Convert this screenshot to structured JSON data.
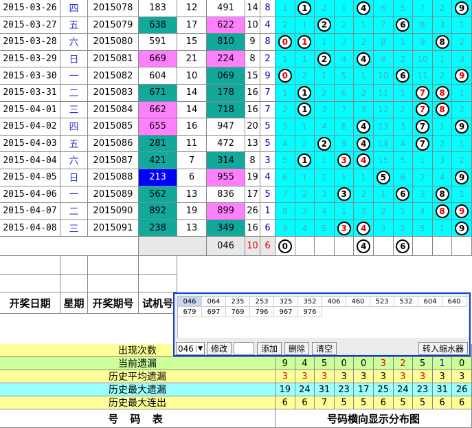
{
  "rows": [
    {
      "date": "2015-03-26",
      "weekday": "四",
      "period": "2015078",
      "trial": "183",
      "trialHl": "",
      "span": "12",
      "num": "491",
      "numHl": "",
      "sum": "14",
      "last": "8",
      "dist": [
        {
          "v": "1"
        },
        {
          "v": "1",
          "ball": true
        },
        {
          "v": "2"
        },
        {
          "v": "1"
        },
        {
          "v": "4",
          "ball": true
        },
        {
          "v": "6"
        },
        {
          "v": "5"
        },
        {
          "v": "7"
        },
        {
          "v": "2"
        },
        {
          "v": "9",
          "ball": true
        }
      ]
    },
    {
      "date": "2015-03-27",
      "weekday": "五",
      "period": "2015079",
      "trial": "638",
      "trialHl": "t",
      "span": "17",
      "num": "622",
      "numHl": "p",
      "sum": "10",
      "last": "4",
      "dist": [
        {
          "v": "2"
        },
        {
          "v": "1"
        },
        {
          "v": "2",
          "ball": true
        },
        {
          "v": "2"
        },
        {
          "v": "1"
        },
        {
          "v": "7"
        },
        {
          "v": "6",
          "ball": true
        },
        {
          "v": "8"
        },
        {
          "v": "3"
        },
        {
          "v": "1"
        }
      ]
    },
    {
      "date": "2015-03-28",
      "weekday": "六",
      "period": "2015080",
      "trial": "591",
      "trialHl": "",
      "span": "15",
      "num": "810",
      "numHl": "t",
      "sum": "9",
      "last": "8",
      "dist": [
        {
          "v": "0",
          "ball": true,
          "red": true
        },
        {
          "v": "1",
          "ball": true,
          "red": true
        },
        {
          "v": "1"
        },
        {
          "v": "3"
        },
        {
          "v": "2"
        },
        {
          "v": "8"
        },
        {
          "v": "1"
        },
        {
          "v": "9"
        },
        {
          "v": "8",
          "ball": true
        },
        {
          "v": "2"
        }
      ]
    },
    {
      "date": "2015-03-29",
      "weekday": "日",
      "period": "2015081",
      "trial": "669",
      "trialHl": "p",
      "span": "21",
      "num": "224",
      "numHl": "p",
      "sum": "8",
      "last": "2",
      "dist": [
        {
          "v": "1"
        },
        {
          "v": "1"
        },
        {
          "v": "2",
          "ball": true
        },
        {
          "v": "4"
        },
        {
          "v": "4",
          "ball": true
        },
        {
          "v": "9"
        },
        {
          "v": "2"
        },
        {
          "v": "10"
        },
        {
          "v": "1"
        },
        {
          "v": "3"
        }
      ]
    },
    {
      "date": "2015-03-30",
      "weekday": "一",
      "period": "2015082",
      "trial": "604",
      "trialHl": "",
      "span": "10",
      "num": "069",
      "numHl": "t",
      "sum": "15",
      "last": "9",
      "dist": [
        {
          "v": "0",
          "ball": true,
          "red": true
        },
        {
          "v": "2"
        },
        {
          "v": "1"
        },
        {
          "v": "5"
        },
        {
          "v": "1"
        },
        {
          "v": "10"
        },
        {
          "v": "6",
          "ball": true
        },
        {
          "v": "11"
        },
        {
          "v": "2"
        },
        {
          "v": "9",
          "ball": true,
          "red": true
        }
      ]
    },
    {
      "date": "2015-03-31",
      "weekday": "二",
      "period": "2015083",
      "trial": "671",
      "trialHl": "t",
      "span": "14",
      "num": "178",
      "numHl": "t",
      "sum": "16",
      "last": "7",
      "dist": [
        {
          "v": "1"
        },
        {
          "v": "1",
          "ball": true
        },
        {
          "v": "2"
        },
        {
          "v": "6"
        },
        {
          "v": "2"
        },
        {
          "v": "11"
        },
        {
          "v": "1"
        },
        {
          "v": "7",
          "ball": true,
          "red": true
        },
        {
          "v": "8",
          "ball": true,
          "red": true
        },
        {
          "v": "1"
        }
      ]
    },
    {
      "date": "2015-04-01",
      "weekday": "三",
      "period": "2015084",
      "trial": "662",
      "trialHl": "p",
      "span": "14",
      "num": "718",
      "numHl": "t",
      "sum": "16",
      "last": "7",
      "dist": [
        {
          "v": "2"
        },
        {
          "v": "1",
          "ball": true
        },
        {
          "v": "3"
        },
        {
          "v": "7"
        },
        {
          "v": "3"
        },
        {
          "v": "12"
        },
        {
          "v": "2"
        },
        {
          "v": "7",
          "ball": true,
          "red": true
        },
        {
          "v": "8",
          "ball": true,
          "red": true
        },
        {
          "v": "2"
        }
      ]
    },
    {
      "date": "2015-04-02",
      "weekday": "四",
      "period": "2015085",
      "trial": "655",
      "trialHl": "p",
      "span": "16",
      "num": "947",
      "numHl": "",
      "sum": "20",
      "last": "5",
      "dist": [
        {
          "v": "3"
        },
        {
          "v": "1"
        },
        {
          "v": "4"
        },
        {
          "v": "8"
        },
        {
          "v": "4",
          "ball": true
        },
        {
          "v": "13"
        },
        {
          "v": "3"
        },
        {
          "v": "7",
          "ball": true
        },
        {
          "v": "1"
        },
        {
          "v": "9",
          "ball": true
        }
      ]
    },
    {
      "date": "2015-04-03",
      "weekday": "五",
      "period": "2015086",
      "trial": "281",
      "trialHl": "t",
      "span": "11",
      "num": "472",
      "numHl": "",
      "sum": "13",
      "last": "5",
      "dist": [
        {
          "v": "4"
        },
        {
          "v": "2"
        },
        {
          "v": "2",
          "ball": true
        },
        {
          "v": "9"
        },
        {
          "v": "4",
          "ball": true
        },
        {
          "v": "14"
        },
        {
          "v": "4"
        },
        {
          "v": "7",
          "ball": true
        },
        {
          "v": "2"
        },
        {
          "v": "1"
        }
      ]
    },
    {
      "date": "2015-04-04",
      "weekday": "六",
      "period": "2015087",
      "trial": "421",
      "trialHl": "t",
      "span": "7",
      "num": "314",
      "numHl": "t",
      "sum": "8",
      "last": "3",
      "dist": [
        {
          "v": "5"
        },
        {
          "v": "1",
          "ball": true
        },
        {
          "v": "1"
        },
        {
          "v": "3",
          "ball": true,
          "red": true
        },
        {
          "v": "4",
          "ball": true,
          "red": true
        },
        {
          "v": "15"
        },
        {
          "v": "5"
        },
        {
          "v": "1"
        },
        {
          "v": "3"
        },
        {
          "v": "2"
        }
      ]
    },
    {
      "date": "2015-04-05",
      "weekday": "日",
      "period": "2015088",
      "trial": "213",
      "trialHl": "b",
      "span": "6",
      "num": "955",
      "numHl": "p",
      "sum": "19",
      "last": "4",
      "dist": [
        {
          "v": "6"
        },
        {
          "v": "1"
        },
        {
          "v": "2"
        },
        {
          "v": "1"
        },
        {
          "v": "1"
        },
        {
          "v": "5",
          "ball": true
        },
        {
          "v": "6"
        },
        {
          "v": "2"
        },
        {
          "v": "4"
        },
        {
          "v": "9",
          "ball": true
        }
      ]
    },
    {
      "date": "2015-04-06",
      "weekday": "一",
      "period": "2015089",
      "trial": "562",
      "trialHl": "t",
      "span": "13",
      "num": "836",
      "numHl": "",
      "sum": "17",
      "last": "5",
      "dist": [
        {
          "v": "7"
        },
        {
          "v": "2"
        },
        {
          "v": "3"
        },
        {
          "v": "3",
          "ball": true
        },
        {
          "v": "2"
        },
        {
          "v": "1"
        },
        {
          "v": "6",
          "ball": true
        },
        {
          "v": "3"
        },
        {
          "v": "8",
          "ball": true
        },
        {
          "v": "1"
        }
      ]
    },
    {
      "date": "2015-04-07",
      "weekday": "二",
      "period": "2015090",
      "trial": "892",
      "trialHl": "t",
      "span": "19",
      "num": "899",
      "numHl": "p",
      "sum": "26",
      "last": "1",
      "dist": [
        {
          "v": "8"
        },
        {
          "v": "3"
        },
        {
          "v": "4"
        },
        {
          "v": "1"
        },
        {
          "v": "3"
        },
        {
          "v": "2"
        },
        {
          "v": "1"
        },
        {
          "v": "4"
        },
        {
          "v": "8",
          "ball": true,
          "red": true
        },
        {
          "v": "9",
          "ball": true,
          "red": true
        }
      ]
    },
    {
      "date": "2015-04-08",
      "weekday": "三",
      "period": "2015091",
      "trial": "238",
      "trialHl": "t",
      "span": "13",
      "num": "349",
      "numHl": "t",
      "sum": "16",
      "last": "6",
      "dist": [
        {
          "v": "9"
        },
        {
          "v": "4"
        },
        {
          "v": "5"
        },
        {
          "v": "3",
          "ball": true,
          "red": true
        },
        {
          "v": "4",
          "ball": true,
          "red": true
        },
        {
          "v": "3"
        },
        {
          "v": "2"
        },
        {
          "v": "5"
        },
        {
          "v": "1"
        },
        {
          "v": "9",
          "ball": true
        }
      ]
    }
  ],
  "forecast": {
    "num": "046",
    "sum": "10",
    "last": "6",
    "balls": [
      {
        "v": "0",
        "col": 0
      },
      {
        "v": "4",
        "col": 4
      },
      {
        "v": "6",
        "col": 6
      }
    ]
  },
  "headers": {
    "date": "开奖日期",
    "weekday": "星期",
    "period": "开奖期号",
    "trial": "试机号"
  },
  "stats": [
    {
      "label": "出现次数",
      "bg": "#ffff99",
      "values": [
        "",
        "",
        "",
        "",
        "",
        "",
        "",
        "",
        "",
        ""
      ]
    },
    {
      "label": "当前遗漏",
      "bg": "#ccff99",
      "values": [
        "9",
        "4",
        "5",
        "0",
        "0",
        "3",
        "2",
        "5",
        "1",
        "0"
      ],
      "colors": [
        "#000",
        "#000",
        "#000",
        "#000",
        "#000",
        "#e00000",
        "#e00000",
        "#000",
        "#0000cc",
        "#000"
      ]
    },
    {
      "label": "历史平均遗漏",
      "bg": "#ffff99",
      "values": [
        "3",
        "3",
        "3",
        "3",
        "3",
        "3",
        "3",
        "3",
        "3",
        "3"
      ],
      "colors": [
        "#e00000",
        "#e00000",
        "#e00000",
        "#000",
        "#000",
        "#000",
        "#e00000",
        "#e00000",
        "#000",
        "#000"
      ]
    },
    {
      "label": "历史最大遗漏",
      "bg": "#99ffff",
      "values": [
        "19",
        "24",
        "31",
        "23",
        "17",
        "25",
        "24",
        "23",
        "31",
        "26"
      ]
    },
    {
      "label": "历史最大连出",
      "bg": "#ffff99",
      "values": [
        "6",
        "6",
        "7",
        "5",
        "5",
        "6",
        "5",
        "5",
        "6",
        "6"
      ]
    }
  ],
  "footer": {
    "left": "号 码 表",
    "right": "号码横向显示分布图"
  },
  "panel": {
    "items": [
      "046",
      "064",
      "235",
      "253",
      "325",
      "352",
      "406",
      "460",
      "523",
      "532",
      "604",
      "640",
      "679",
      "697",
      "769",
      "796",
      "967",
      "976"
    ],
    "select_value": "046",
    "btn_modify": "修改",
    "btn_add": "添加",
    "btn_delete": "删除",
    "btn_clear": "清空",
    "btn_import": "转入缩水器"
  },
  "colors": {
    "teal": "#10a99c",
    "pink": "#ff80ff",
    "blue": "#0000ff",
    "cyan": "#00ffff",
    "panelBorder": "#0a3bd6"
  }
}
